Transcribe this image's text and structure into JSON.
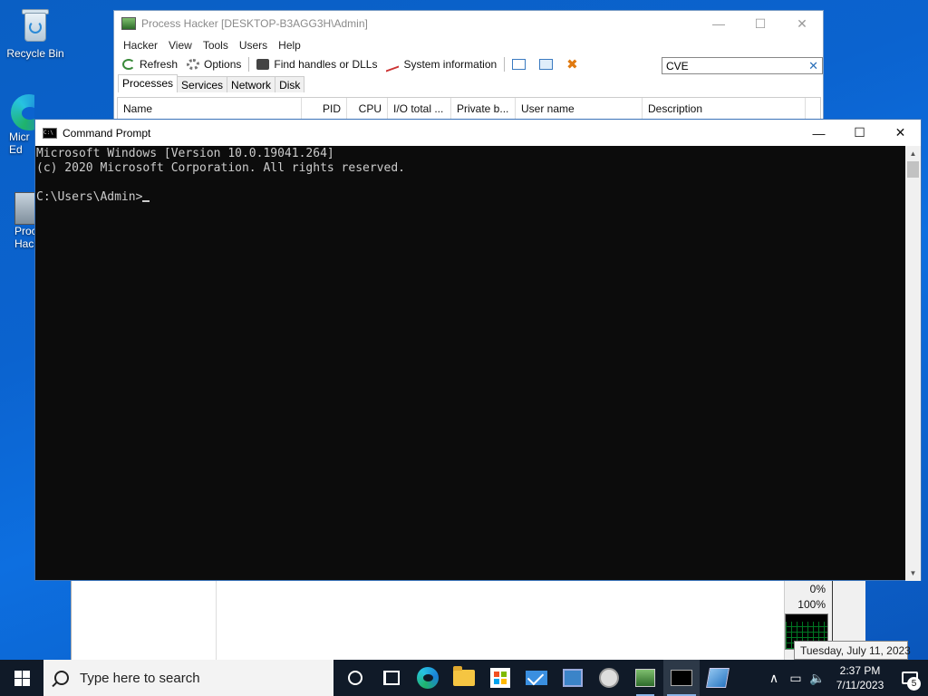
{
  "desktop": {
    "icons": [
      {
        "label": "Recycle Bin"
      },
      {
        "label": "Micr Ed"
      },
      {
        "label": "Proc Hack"
      }
    ]
  },
  "process_hacker": {
    "title": "Process Hacker [DESKTOP-B3AGG3H\\Admin]",
    "menu": [
      "Hacker",
      "View",
      "Tools",
      "Users",
      "Help"
    ],
    "toolbar": {
      "refresh": "Refresh",
      "options": "Options",
      "find_handles": "Find handles or DLLs",
      "system_info": "System information"
    },
    "search_value": "CVE",
    "tabs": [
      "Processes",
      "Services",
      "Network",
      "Disk"
    ],
    "columns": [
      "Name",
      "PID",
      "CPU",
      "I/O total ...",
      "Private b...",
      "User name",
      "Description"
    ],
    "graph_labels": {
      "top": "0%",
      "bottom": "100%"
    }
  },
  "tooltip": "Tuesday, July 11, 2023",
  "cmd": {
    "title": "Command Prompt",
    "lines": [
      "Microsoft Windows [Version 10.0.19041.264]",
      "(c) 2020 Microsoft Corporation. All rights reserved.",
      "",
      "C:\\Users\\Admin>"
    ]
  },
  "taskbar": {
    "search_placeholder": "Type here to search",
    "time": "2:37 PM",
    "date": "7/11/2023",
    "notification_count": "5"
  },
  "colors": {
    "desktop_bg": "#0b63cf",
    "taskbar_bg": "#101a28",
    "console_bg": "#0c0c0c",
    "console_fg": "#cccccc"
  }
}
